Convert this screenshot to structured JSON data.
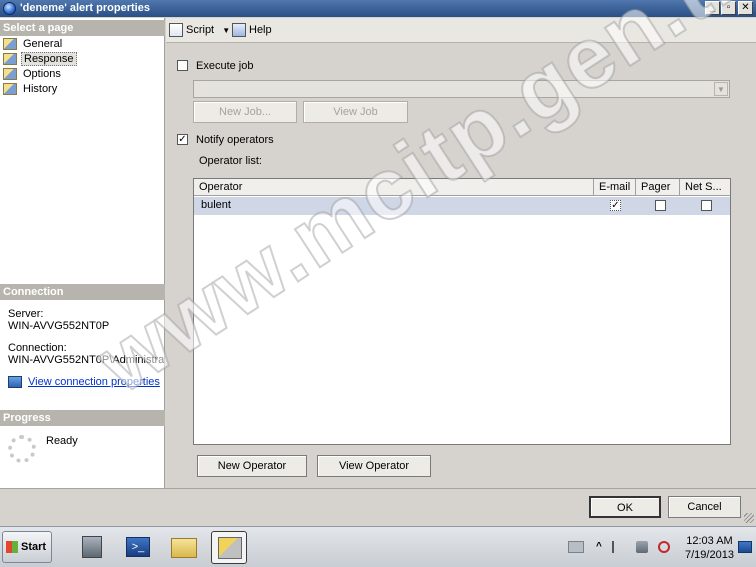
{
  "window": {
    "title": "'deneme' alert properties"
  },
  "left_panel": {
    "select_page_header": "Select a page",
    "pages": [
      {
        "label": "General",
        "icon": "page-icon"
      },
      {
        "label": "Response",
        "icon": "page-icon"
      },
      {
        "label": "Options",
        "icon": "page-icon"
      },
      {
        "label": "History",
        "icon": "page-icon"
      }
    ],
    "selected_page": "Response",
    "connection_header": "Connection",
    "server_label": "Server:",
    "server_value": "WIN-AVVG552NT0P",
    "connection_label": "Connection:",
    "connection_value": "WIN-AVVG552NT0P\\Administrato",
    "view_connection_link": "View connection properties",
    "progress_header": "Progress",
    "progress_status": "Ready"
  },
  "toolbar": {
    "script_label": "Script",
    "help_label": "Help"
  },
  "response": {
    "execute_job_label": "Execute job",
    "execute_job_checked": false,
    "new_job_label": "New Job...",
    "view_job_label": "View Job",
    "notify_operators_label": "Notify operators",
    "notify_operators_checked": true,
    "operator_list_label": "Operator list:",
    "columns": [
      "Operator",
      "E-mail",
      "Pager",
      "Net S..."
    ],
    "rows": [
      {
        "operator": "bulent",
        "email": true,
        "pager": false,
        "net_send": false
      }
    ],
    "new_operator_label": "New Operator",
    "view_operator_label": "View Operator"
  },
  "dialog_buttons": {
    "ok_label": "OK",
    "cancel_label": "Cancel"
  },
  "taskbar": {
    "start_label": "Start",
    "time": "12:03 AM",
    "date": "7/19/2013"
  },
  "watermark": "www.mcitp.gen.tr"
}
